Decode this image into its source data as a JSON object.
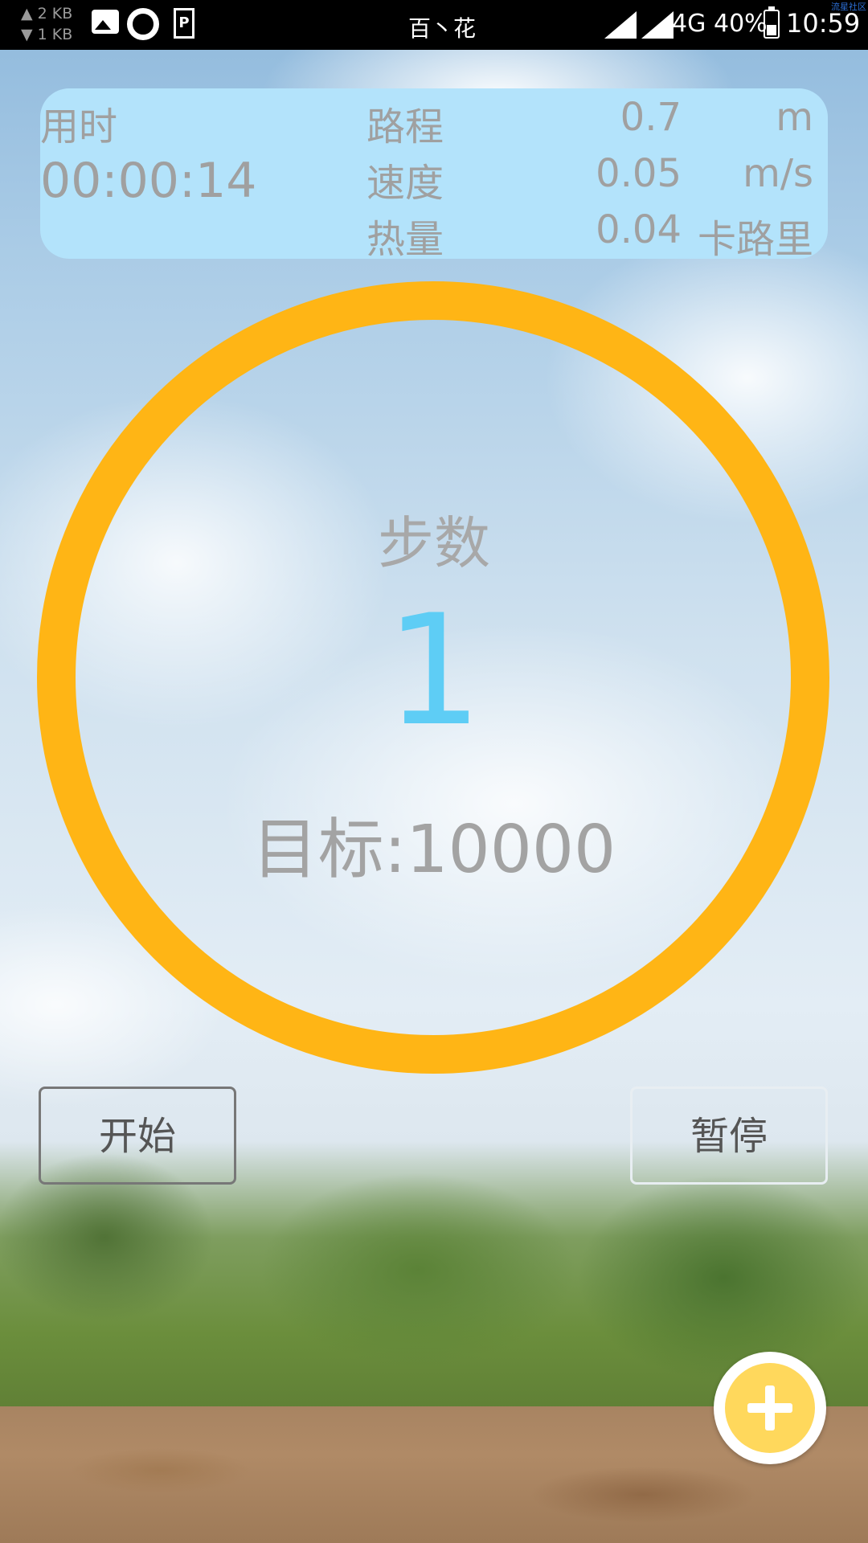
{
  "status_bar": {
    "upload_speed": "▲ 2 KB",
    "download_speed": "▼ 1 KB",
    "carrier": "百丶花",
    "network_type": "4G",
    "battery_percent": "40%",
    "battery_level": 0.4,
    "time": "10:59",
    "watermark": "流星社区",
    "icons": [
      "gallery-icon",
      "sync-icon",
      "parking-icon",
      "signal-icon",
      "battery-icon"
    ]
  },
  "stats": {
    "time_label": "用时",
    "elapsed": "00:00:14",
    "distance_label": "路程",
    "distance_value": "0.7",
    "distance_unit": "m",
    "speed_label": "速度",
    "speed_value": "0.05",
    "speed_unit": "m/s",
    "calories_label": "热量",
    "calories_value": "0.04",
    "calories_unit": "卡路里"
  },
  "counter": {
    "steps_label": "步数",
    "steps": "1",
    "goal": "目标:10000",
    "ring_color": "#ffb515",
    "progress": 0.0001
  },
  "buttons": {
    "start": "开始",
    "pause": "暂停"
  },
  "fab": {
    "icon": "plus-icon",
    "color": "#ffd85c"
  }
}
